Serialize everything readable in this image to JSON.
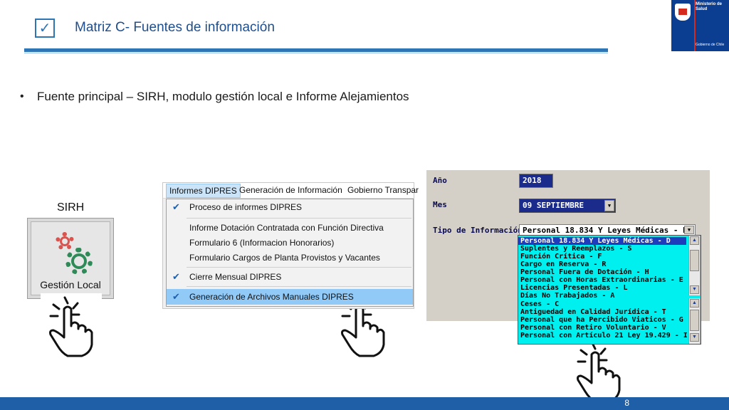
{
  "header": {
    "check_glyph": "✓",
    "title": "Matriz C- Fuentes de información"
  },
  "logo": {
    "ministry": "Ministerio de Salud",
    "government": "Gobierno de Chile",
    "colors": {
      "blue": "#0b3d91",
      "red": "#d52b1e"
    }
  },
  "bullet": {
    "glyph": "•",
    "text": "Fuente principal – SIRH, modulo gestión local e Informe Alejamientos"
  },
  "sirh": {
    "label": "SIRH",
    "button_label": "Gestión Local",
    "icon": "gears-icon"
  },
  "dipres_menu": {
    "menubar": [
      "Informes DIPRES",
      "Generación de Información",
      "Gobierno Transpar"
    ],
    "items": [
      {
        "label": "Proceso de informes DIPRES",
        "checked": true
      },
      {
        "label": "Informe Dotación Contratada con Función Directiva",
        "checked": false
      },
      {
        "label": "Formulario 6 (Informacion Honorarios)",
        "checked": false
      },
      {
        "label": "Formulario Cargos de Planta Provistos y Vacantes",
        "checked": false
      },
      {
        "label": "Cierre Mensual DIPRES",
        "checked": true
      },
      {
        "label": "Generación de Archivos Manuales DIPRES",
        "checked": true
      }
    ],
    "check_glyph": "✔"
  },
  "form": {
    "year_label": "Año",
    "year_value": "2018",
    "month_label": "Mes",
    "month_value": "09 SEPTIEMBRE",
    "type_label": "Tipo de Información",
    "type_value": "Personal 18.834 Y Leyes Médicas - D",
    "options": [
      "Personal 18.834 Y Leyes Médicas - D",
      "Suplentes y Reemplazos - S",
      "Función Crítica - F",
      "Cargo en Reserva - R",
      "Personal Fuera de Dotación - H",
      "Personal con Horas Extraordinarias - E",
      "Licencias Presentadas - L",
      "Días No Trabajados - A",
      "Ceses - C",
      "Antiguedad en Calidad Jurídica - T",
      "Personal que ha Percibido Viaticos - G",
      "Personal con Retiro Voluntario - V",
      "Personal con Artículo 21 Ley 19.429 - I"
    ],
    "arrow_glyph": "▼",
    "up_glyph": "▲",
    "colors": {
      "list_bg": "#00f0f0",
      "highlight": "#1e3dbd"
    }
  },
  "footer": {
    "page_number": "8"
  }
}
